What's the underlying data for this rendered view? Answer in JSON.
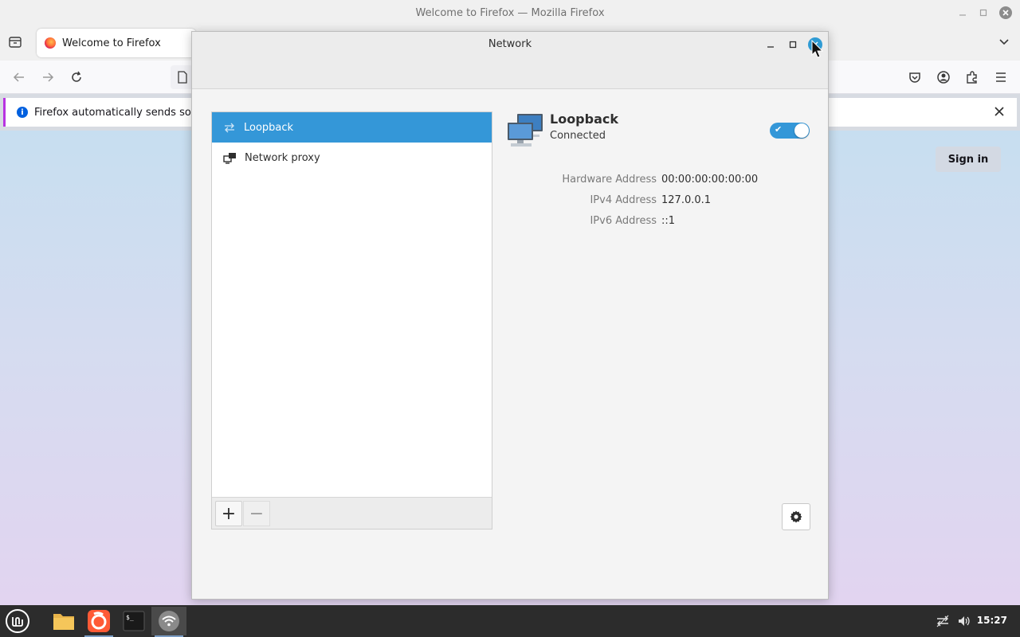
{
  "firefox": {
    "window_title": "Welcome to Firefox — Mozilla Firefox",
    "tab_title": "Welcome to Firefox",
    "notice_text": "Firefox automatically sends some",
    "signin_label": "Sign in"
  },
  "dialog": {
    "title": "Network",
    "list": [
      {
        "label": "Loopback",
        "icon": "loopback-arrows-icon",
        "selected": true
      },
      {
        "label": "Network proxy",
        "icon": "network-proxy-icon",
        "selected": false
      }
    ],
    "add_label": "+",
    "remove_label": "−",
    "detail": {
      "name": "Loopback",
      "status": "Connected",
      "enabled": true,
      "properties": [
        {
          "label": "Hardware Address",
          "value": "00:00:00:00:00:00"
        },
        {
          "label": "IPv4 Address",
          "value": "127.0.0.1"
        },
        {
          "label": "IPv6 Address",
          "value": "::1"
        }
      ]
    }
  },
  "taskbar": {
    "clock": "15:27",
    "apps": [
      "mint-menu-icon",
      "files-icon",
      "firefox-icon",
      "terminal-icon",
      "network-icon"
    ]
  },
  "colors": {
    "accent": "#3497d8",
    "taskbar_bg": "#2c2c2c"
  }
}
